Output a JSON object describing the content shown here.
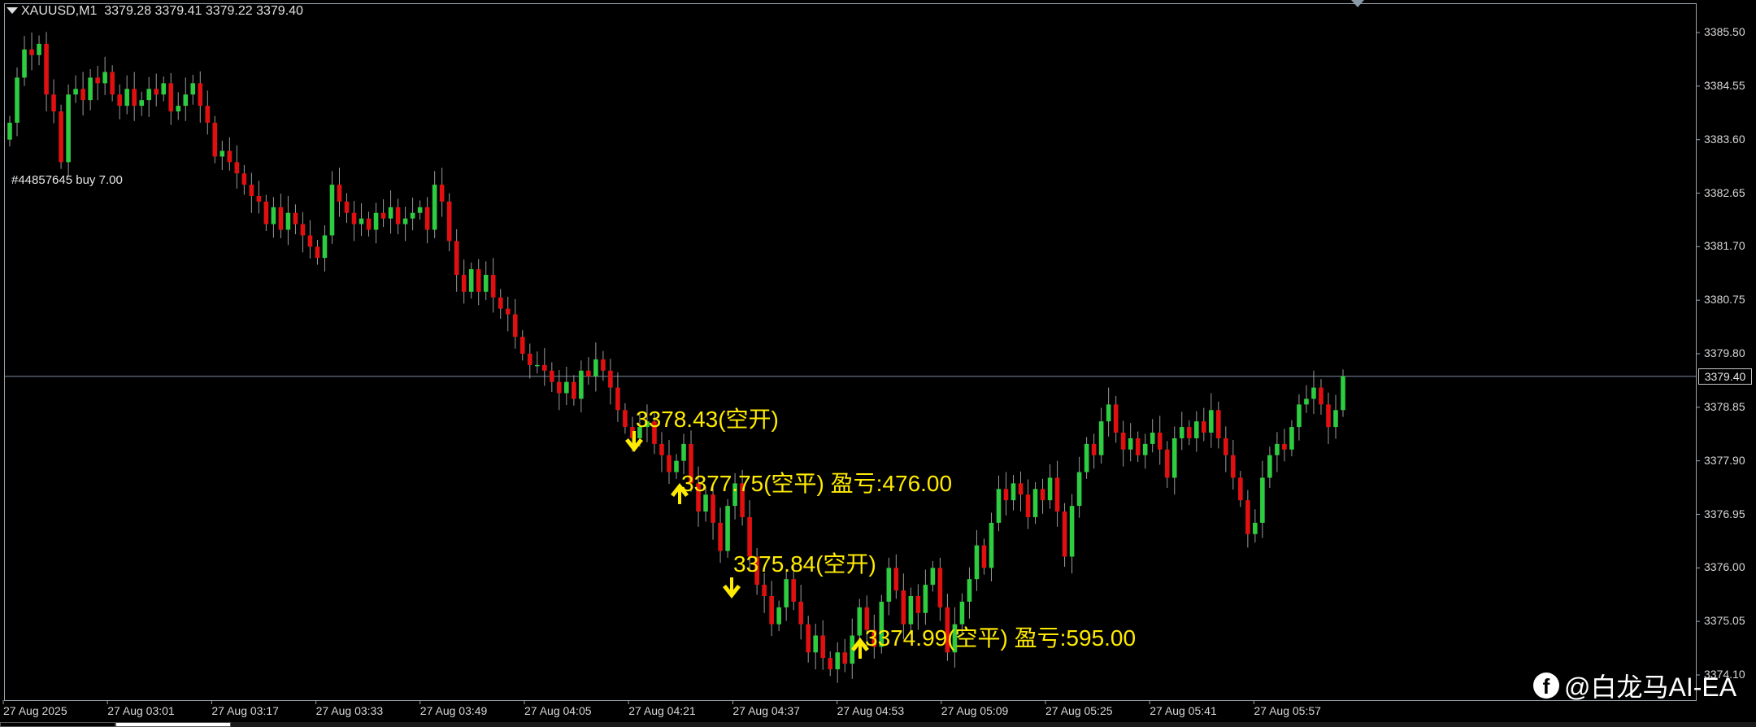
{
  "header": {
    "symbol": "XAUUSD,M1",
    "ohlc": "3379.28 3379.41 3379.22 3379.40"
  },
  "order_label": "#44857645 buy 7.00",
  "price_axis": {
    "labels": [
      "3385.50",
      "3384.55",
      "3383.60",
      "3382.65",
      "3381.70",
      "3380.75",
      "3379.80",
      "3378.85",
      "3377.90",
      "3376.95",
      "3376.00",
      "3375.05",
      "3374.10"
    ],
    "current_price": "3379.40"
  },
  "time_axis": {
    "labels": [
      "27 Aug 2025",
      "27 Aug 03:01",
      "27 Aug 03:17",
      "27 Aug 03:33",
      "27 Aug 03:49",
      "27 Aug 04:05",
      "27 Aug 04:21",
      "27 Aug 04:37",
      "27 Aug 04:53",
      "27 Aug 05:09",
      "27 Aug 05:25",
      "27 Aug 05:41",
      "27 Aug 05:57"
    ]
  },
  "annotations": [
    {
      "text": "3378.43(空开)",
      "arrow": "down"
    },
    {
      "text": "3377.75(空平) 盈亏:476.00",
      "arrow": "up"
    },
    {
      "text": "3375.84(空开)",
      "arrow": "down"
    },
    {
      "text": "3374.99(空平) 盈亏:595.00",
      "arrow": "up"
    }
  ],
  "watermark": "@白龙马AI-EA",
  "watermark_icon": "facebook-icon",
  "colors": {
    "background": "#000000",
    "bull_candle": "#2ecc40",
    "bear_candle": "#e01010",
    "wick": "#9a9a9a",
    "annotation": "#ffeb00",
    "price_line": "#7a8ca0",
    "axis_text": "#d8d8d8"
  },
  "chart_data": {
    "type": "candlestick",
    "symbol": "XAUUSD",
    "timeframe": "M1",
    "ylim": [
      3373.9,
      3385.9
    ],
    "current_price": 3379.4,
    "close_series": [
      3383.9,
      3384.7,
      3385.2,
      3385.1,
      3385.3,
      3384.4,
      3384.1,
      3383.2,
      3384.4,
      3384.5,
      3384.3,
      3384.7,
      3384.6,
      3384.8,
      3384.4,
      3384.2,
      3384.5,
      3384.2,
      3384.3,
      3384.5,
      3384.4,
      3384.6,
      3384.1,
      3384.2,
      3384.4,
      3384.6,
      3384.2,
      3383.9,
      3383.3,
      3383.4,
      3383.2,
      3383.0,
      3382.8,
      3382.6,
      3382.5,
      3382.1,
      3382.4,
      3382.0,
      3382.3,
      3382.1,
      3381.9,
      3381.7,
      3381.5,
      3381.9,
      3382.8,
      3382.5,
      3382.3,
      3382.1,
      3382.2,
      3382.0,
      3382.3,
      3382.2,
      3382.4,
      3382.1,
      3382.2,
      3382.3,
      3382.4,
      3382.0,
      3382.8,
      3382.5,
      3381.8,
      3381.2,
      3380.9,
      3381.3,
      3380.9,
      3381.2,
      3380.8,
      3380.6,
      3380.5,
      3380.1,
      3379.8,
      3379.6,
      3379.6,
      3379.5,
      3379.3,
      3379.1,
      3379.3,
      3379.0,
      3379.5,
      3379.4,
      3379.7,
      3379.5,
      3379.2,
      3378.8,
      3378.5,
      3378.3,
      3378.5,
      3378.6,
      3378.2,
      3378.0,
      3377.7,
      3377.9,
      3378.2,
      3377.5,
      3377.0,
      3377.3,
      3376.8,
      3376.3,
      3377.1,
      3377.5,
      3376.9,
      3376.2,
      3375.7,
      3375.5,
      3375.0,
      3375.3,
      3375.8,
      3375.4,
      3375.0,
      3374.5,
      3374.8,
      3374.4,
      3374.2,
      3374.5,
      3374.3,
      3374.8,
      3375.3,
      3374.9,
      3374.6,
      3375.4,
      3376.0,
      3375.6,
      3375.0,
      3375.5,
      3375.2,
      3375.7,
      3376.0,
      3375.3,
      3374.5,
      3375.0,
      3375.4,
      3375.8,
      3376.4,
      3376.0,
      3376.8,
      3377.4,
      3377.2,
      3377.5,
      3377.3,
      3376.9,
      3377.4,
      3377.2,
      3377.6,
      3377.0,
      3376.2,
      3377.1,
      3377.7,
      3378.2,
      3378.0,
      3378.6,
      3378.9,
      3378.4,
      3378.1,
      3378.3,
      3378.0,
      3378.2,
      3378.4,
      3378.1,
      3377.6,
      3378.3,
      3378.5,
      3378.3,
      3378.6,
      3378.4,
      3378.8,
      3378.3,
      3378.0,
      3377.6,
      3377.2,
      3376.6,
      3376.8,
      3377.6,
      3378.0,
      3378.2,
      3378.1,
      3378.5,
      3378.9,
      3379.0,
      3379.2,
      3378.9,
      3378.5,
      3378.8,
      3379.4
    ]
  }
}
